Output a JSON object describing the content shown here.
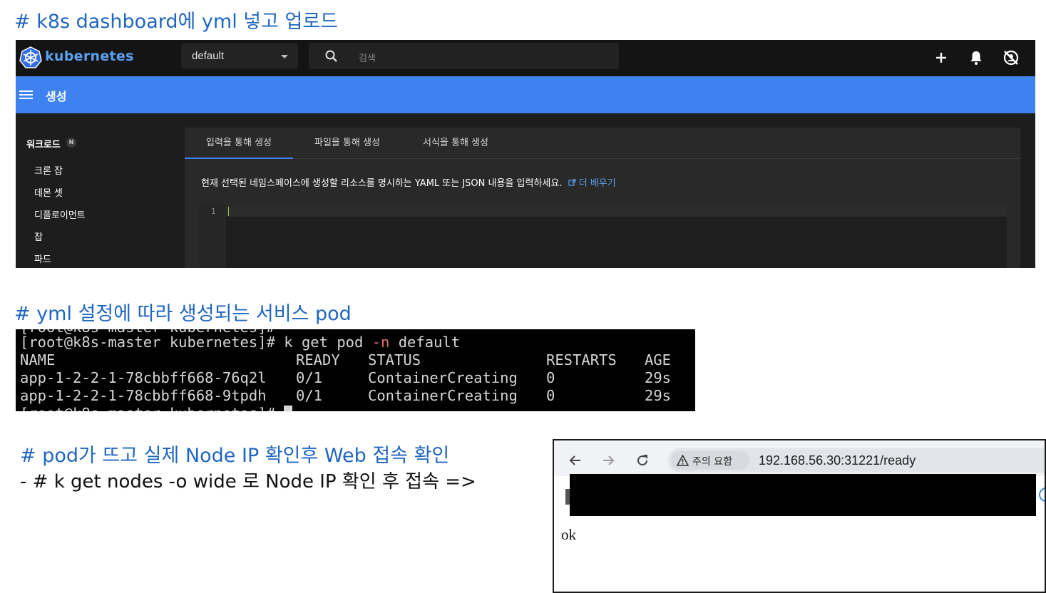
{
  "headings": {
    "h1": "# k8s dashboard에 yml 넣고 업로드",
    "h2": "# yml 설정에 따라 생성되는 서비스 pod",
    "h3": "# pod가 뜨고 실제 Node IP 확인후 Web 접속 확인",
    "h3_sub": "- # k get nodes -o wide 로 Node IP 확인 후 접속 =>"
  },
  "dashboard": {
    "logo_text": "kubernetes",
    "namespace": "default",
    "search_placeholder": "검색",
    "toolbar_icons": [
      "plus-icon",
      "bell-icon",
      "account-off-icon"
    ],
    "page_title": "생성",
    "sidebar": {
      "section": "워크로드",
      "section_badge": "N",
      "items": [
        {
          "label": "크론 잡"
        },
        {
          "label": "데몬 셋"
        },
        {
          "label": "디플로이먼트"
        },
        {
          "label": "잡"
        },
        {
          "label": "파드"
        }
      ]
    },
    "tabs": [
      {
        "label": "입력을 통해 생성",
        "active": true
      },
      {
        "label": "파일을 통해 생성",
        "active": false
      },
      {
        "label": "서식을 통해 생성",
        "active": false
      }
    ],
    "description": "현재 선택된 네임스페이스에 생성할 리소스를 명시하는 YAML 또는 JSON 내용을 입력하세요.",
    "learn_more": "더 배우기",
    "editor_line_number": "1",
    "accent_color": "#3e82f0"
  },
  "terminal": {
    "prompt": "[root@k8s-master kubernetes]# ",
    "command": "k get pod ",
    "flag": "-n",
    "flag_value": " default",
    "headers": [
      "NAME",
      "READY",
      "STATUS",
      "RESTARTS",
      "AGE"
    ],
    "rows": [
      [
        "app-1-2-2-1-78cbbff668-76q2l",
        "0/1",
        "ContainerCreating",
        "0",
        "29s"
      ],
      [
        "app-1-2-2-1-78cbbff668-9tpdh",
        "0/1",
        "ContainerCreating",
        "0",
        "29s"
      ]
    ],
    "last_prompt": "[root@k8s-master kubernetes]# "
  },
  "browser": {
    "warning_label": "주의 요함",
    "url": "192.168.56.30:31221/ready",
    "page_text": "ok"
  }
}
